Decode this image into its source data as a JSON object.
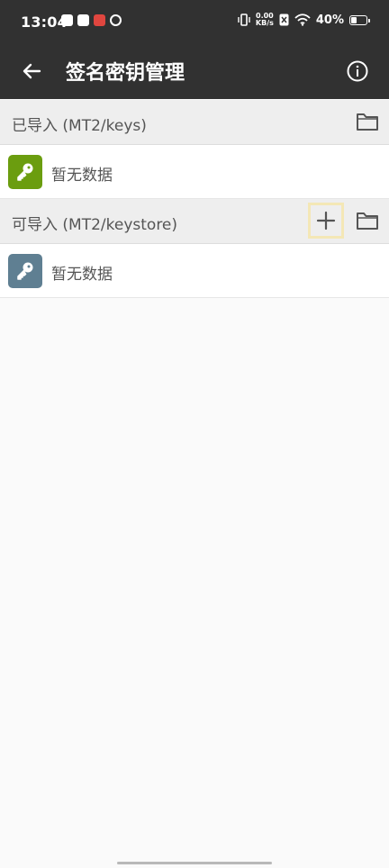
{
  "status_bar": {
    "time": "13:04",
    "net_speed_value": "0.00",
    "net_speed_unit": "KB/s",
    "battery_percent": "40%"
  },
  "toolbar": {
    "title": "签名密钥管理",
    "back_icon": "back-arrow-icon",
    "info_icon": "info-icon"
  },
  "sections": [
    {
      "title": "已导入 (MT2/keys)",
      "empty_text": "暂无数据",
      "badge_color": "#6b9d0f"
    },
    {
      "title": "可导入 (MT2/keystore)",
      "empty_text": "暂无数据",
      "badge_color": "#5f7f92"
    }
  ],
  "colors": {
    "header_bg": "#313131",
    "section_bg": "#eeeeee",
    "row_bg": "#ffffff",
    "page_bg": "#fafafa",
    "highlight_border": "#f4e7b6"
  }
}
